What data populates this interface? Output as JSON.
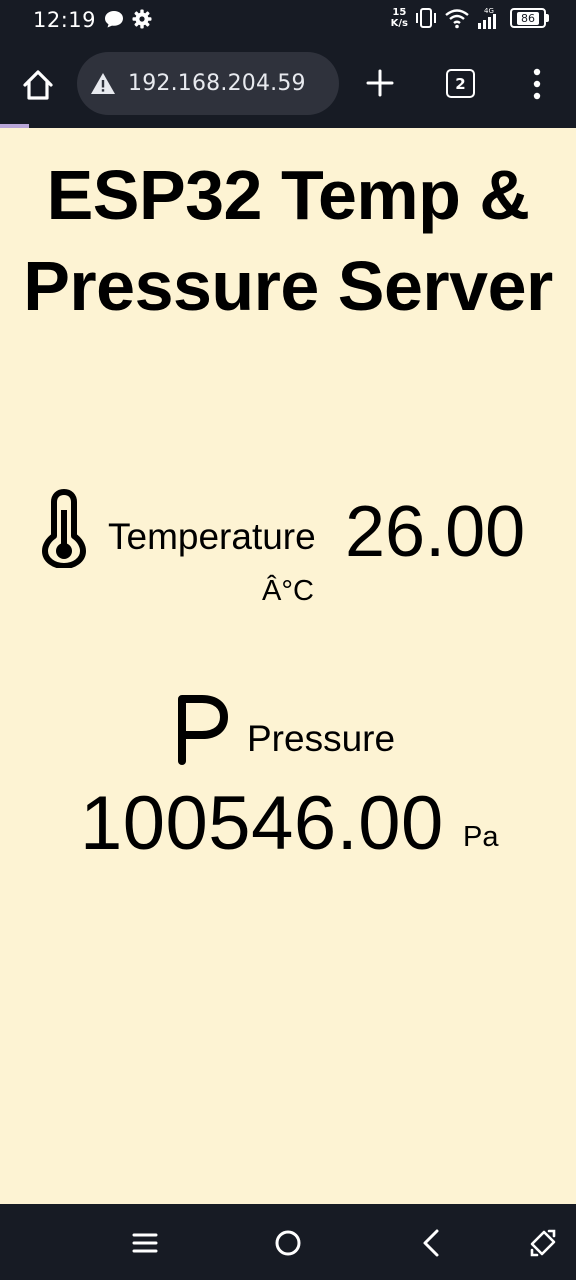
{
  "status_bar": {
    "time": "12:19",
    "left_icons": [
      "message-icon",
      "settings-gear-icon"
    ],
    "net_speed_value": "15",
    "net_speed_unit": "K/s",
    "right_icons": [
      "vibrate-icon",
      "wifi-icon",
      "signal-4g-icon"
    ],
    "network_type": "4G",
    "battery_level": "86"
  },
  "browser": {
    "url": "192.168.204.59",
    "tab_count": "2",
    "security_icon": "warning-triangle-icon",
    "progress_percent": 5
  },
  "page": {
    "title": "ESP32 Temp & Pressure Server",
    "temperature": {
      "label": "Temperature",
      "value": "26.00",
      "unit": "Â°C",
      "icon": "thermometer-icon"
    },
    "pressure": {
      "label": "Pressure",
      "value": "100546.00",
      "unit": "Pa",
      "icon": "letter-p-icon"
    },
    "background_color": "#fdf3d3"
  },
  "nav_bar": {
    "buttons": [
      "recent-apps-icon",
      "home-circle-icon",
      "back-icon",
      "rotate-icon"
    ]
  }
}
